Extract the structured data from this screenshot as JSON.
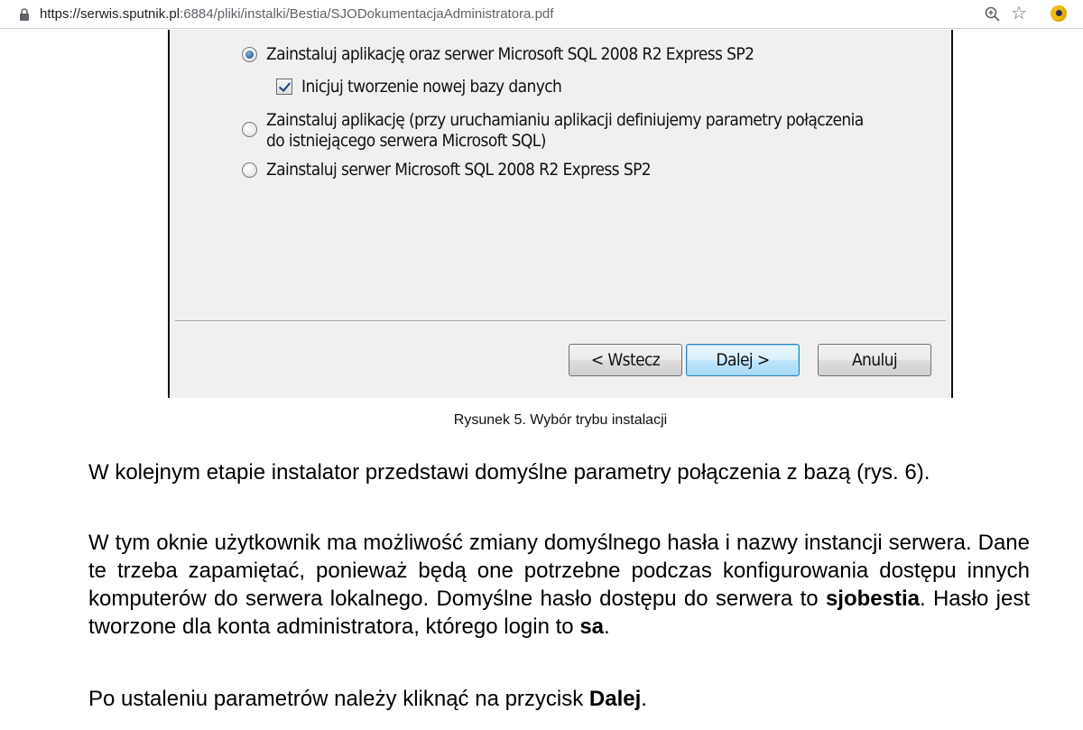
{
  "browser": {
    "url_host": "https://serwis.sputnik.pl",
    "url_rest": ":6884/pliki/instalki/Bestia/SJODokumentacjaAdministratora.pdf",
    "icons": [
      "lock-icon",
      "zoom-icon",
      "star-icon",
      "extension-icon"
    ]
  },
  "dialog": {
    "option_full": "Zainstaluj aplikację oraz serwer Microsoft SQL 2008 R2 Express SP2",
    "checkbox_new_db": "Inicjuj tworzenie nowej bazy danych",
    "option_app_line1": "Zainstaluj aplikację (przy uruchamianiu aplikacji definiujemy parametry połączenia",
    "option_app_line2": "do istniejącego serwera Microsoft SQL)",
    "option_server": "Zainstaluj serwer Microsoft SQL 2008 R2 Express SP2",
    "back_button": "< Wstecz",
    "next_button": "Dalej >",
    "cancel_button": "Anuluj"
  },
  "document": {
    "caption": "Rysunek 5. Wybór trybu instalacji",
    "p1": "W kolejnym etapie instalator przedstawi domyślne parametry połączenia z bazą (rys. 6).",
    "p2_a": "W tym oknie użytkownik ma możliwość zmiany domyślnego hasła i nazwy instancji serwera. Dane te trzeba zapamiętać, ponieważ będą one potrzebne podczas konfigurowania dostępu innych komputerów do serwera lokalnego. Domyślne hasło dostępu do serwera to ",
    "p2_password": "sjobestia",
    "p2_b": ". Hasło jest tworzone dla konta administratora, którego login to ",
    "p2_login": "sa",
    "p2_c": ".",
    "p3_a": "Po ustaleniu parametrów należy kliknąć na przycisk ",
    "p3_button": "Dalej",
    "p3_c": "."
  }
}
